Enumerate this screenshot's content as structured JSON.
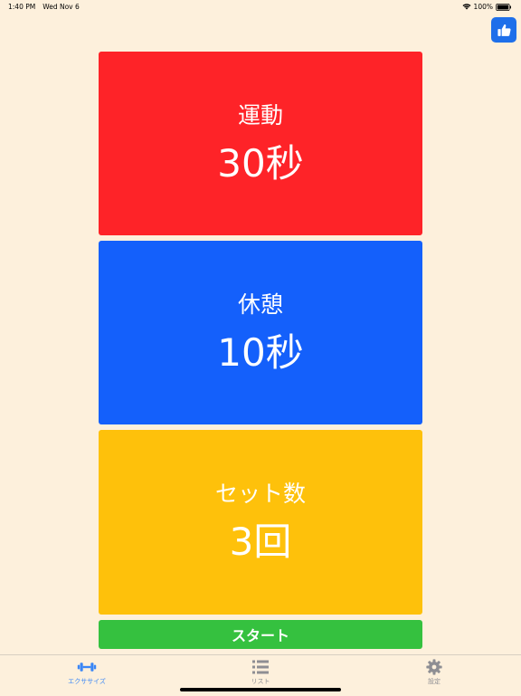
{
  "status_bar": {
    "time": "1:40 PM",
    "date": "Wed Nov 6",
    "battery": "100%"
  },
  "like_button": {
    "icon": "thumbs-up-icon",
    "color": "#1E6FEA"
  },
  "cards": {
    "exercise": {
      "label": "運動",
      "value": "30秒",
      "color": "#FE2328"
    },
    "rest": {
      "label": "休憩",
      "value": "10秒",
      "color": "#1460FB"
    },
    "sets": {
      "label": "セット数",
      "value": "3回",
      "color": "#FEC10B"
    }
  },
  "start_button": {
    "label": "スタート",
    "color": "#35C13F"
  },
  "tab_bar": {
    "active_color": "#3A86F6",
    "inactive_color": "#8E8E93",
    "tabs": [
      {
        "label": "エクササイズ",
        "icon": "dumbbell-icon",
        "active": true
      },
      {
        "label": "リスト",
        "icon": "list-icon",
        "active": false
      },
      {
        "label": "設定",
        "icon": "gear-icon",
        "active": false
      }
    ]
  }
}
